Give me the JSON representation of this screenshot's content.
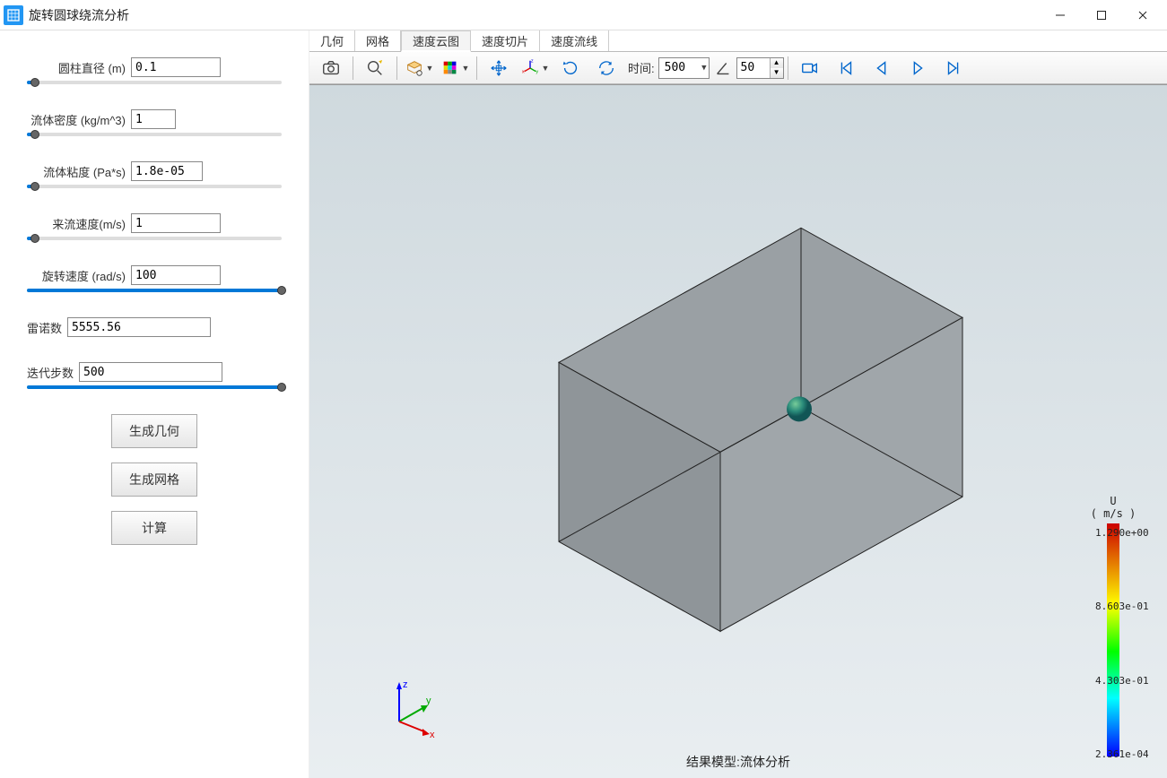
{
  "window": {
    "title": "旋转圆球绕流分析"
  },
  "sidebar": {
    "diameter": {
      "label": "圆柱直径 (m)",
      "value": "0.1",
      "slider_pct": 3
    },
    "density": {
      "label": "流体密度 (kg/m^3)",
      "value": "1",
      "slider_pct": 3
    },
    "viscosity": {
      "label": "流体粘度 (Pa*s)",
      "value": "1.8e-05",
      "slider_pct": 3
    },
    "velocity": {
      "label": "来流速度(m/s)",
      "value": "1",
      "slider_pct": 3
    },
    "rotation": {
      "label": "旋转速度 (rad/s)",
      "value": "100",
      "slider_pct": 100
    },
    "reynolds": {
      "label": "雷诺数",
      "value": "5555.56"
    },
    "steps": {
      "label": "迭代步数",
      "value": "500",
      "slider_pct": 100
    },
    "btn_geom": "生成几何",
    "btn_mesh": "生成网格",
    "btn_calc": "计算"
  },
  "tabs": [
    "几何",
    "网格",
    "速度云图",
    "速度切片",
    "速度流线"
  ],
  "active_tab_index": 2,
  "toolbar": {
    "time_label": "时间:",
    "time_value": "500",
    "step_value": "50",
    "icons": {
      "camera": "camera-icon",
      "zoomfit": "zoom-fit-icon",
      "select": "selection-icon",
      "colormap": "colormap-icon",
      "move": "move-icon",
      "axis": "axis-toggle-icon",
      "rot1": "rotate-y-icon",
      "rot2": "rotate-icon",
      "angle": "angle-icon",
      "video": "record-icon",
      "first": "first-frame-icon",
      "prev": "prev-frame-icon",
      "play": "play-icon",
      "last": "last-frame-icon"
    }
  },
  "legend": {
    "title1": "U",
    "title2": "( m/s )",
    "ticks": [
      "1.290e+00",
      "8.603e-01",
      "4.303e-01",
      "2.361e-04"
    ]
  },
  "viewport_title": "结果模型:流体分析",
  "axes": {
    "x": "x",
    "y": "y",
    "z": "z"
  }
}
